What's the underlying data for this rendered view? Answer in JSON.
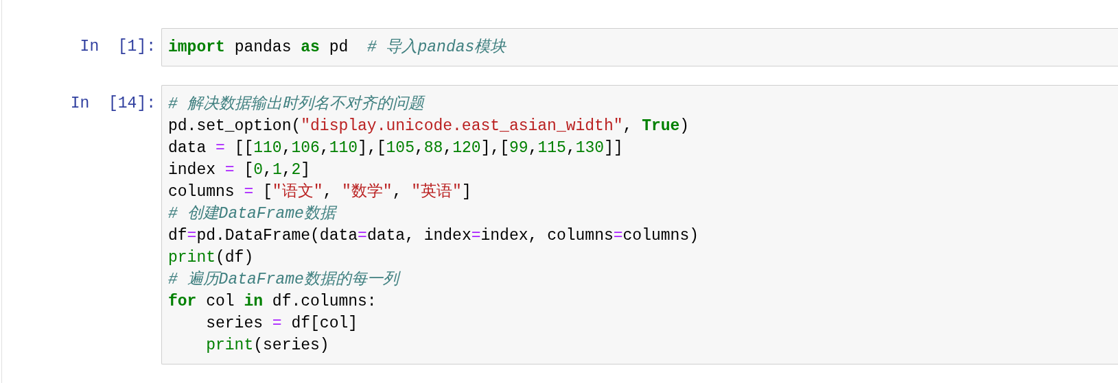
{
  "cells": [
    {
      "prompt": "In  [1]:",
      "lines": [
        {
          "tokens": [
            {
              "kind": "kw",
              "text": "import"
            },
            {
              "kind": "plain",
              "text": " pandas "
            },
            {
              "kind": "kw",
              "text": "as"
            },
            {
              "kind": "plain",
              "text": " pd  "
            },
            {
              "kind": "cmt",
              "text": "# 导入pandas模块"
            }
          ]
        }
      ]
    },
    {
      "prompt": "In  [14]:",
      "lines": [
        {
          "tokens": [
            {
              "kind": "cmt",
              "text": "# 解决数据输出时列名不对齐的问题"
            }
          ]
        },
        {
          "tokens": [
            {
              "kind": "plain",
              "text": "pd.set_option("
            },
            {
              "kind": "str",
              "text": "\"display.unicode.east_asian_width\""
            },
            {
              "kind": "plain",
              "text": ", "
            },
            {
              "kind": "kw",
              "text": "True"
            },
            {
              "kind": "plain",
              "text": ")"
            }
          ]
        },
        {
          "tokens": [
            {
              "kind": "plain",
              "text": "data "
            },
            {
              "kind": "op",
              "text": "="
            },
            {
              "kind": "plain",
              "text": " [["
            },
            {
              "kind": "num",
              "text": "110"
            },
            {
              "kind": "plain",
              "text": ","
            },
            {
              "kind": "num",
              "text": "106"
            },
            {
              "kind": "plain",
              "text": ","
            },
            {
              "kind": "num",
              "text": "110"
            },
            {
              "kind": "plain",
              "text": "],["
            },
            {
              "kind": "num",
              "text": "105"
            },
            {
              "kind": "plain",
              "text": ","
            },
            {
              "kind": "num",
              "text": "88"
            },
            {
              "kind": "plain",
              "text": ","
            },
            {
              "kind": "num",
              "text": "120"
            },
            {
              "kind": "plain",
              "text": "],["
            },
            {
              "kind": "num",
              "text": "99"
            },
            {
              "kind": "plain",
              "text": ","
            },
            {
              "kind": "num",
              "text": "115"
            },
            {
              "kind": "plain",
              "text": ","
            },
            {
              "kind": "num",
              "text": "130"
            },
            {
              "kind": "plain",
              "text": "]]"
            }
          ]
        },
        {
          "tokens": [
            {
              "kind": "plain",
              "text": "index "
            },
            {
              "kind": "op",
              "text": "="
            },
            {
              "kind": "plain",
              "text": " ["
            },
            {
              "kind": "num",
              "text": "0"
            },
            {
              "kind": "plain",
              "text": ","
            },
            {
              "kind": "num",
              "text": "1"
            },
            {
              "kind": "plain",
              "text": ","
            },
            {
              "kind": "num",
              "text": "2"
            },
            {
              "kind": "plain",
              "text": "]"
            }
          ]
        },
        {
          "tokens": [
            {
              "kind": "plain",
              "text": "columns "
            },
            {
              "kind": "op",
              "text": "="
            },
            {
              "kind": "plain",
              "text": " ["
            },
            {
              "kind": "str",
              "text": "\"语文\""
            },
            {
              "kind": "plain",
              "text": ", "
            },
            {
              "kind": "str",
              "text": "\"数学\""
            },
            {
              "kind": "plain",
              "text": ", "
            },
            {
              "kind": "str",
              "text": "\"英语\""
            },
            {
              "kind": "plain",
              "text": "]"
            }
          ]
        },
        {
          "tokens": [
            {
              "kind": "cmt",
              "text": "# 创建DataFrame数据"
            }
          ]
        },
        {
          "tokens": [
            {
              "kind": "plain",
              "text": "df"
            },
            {
              "kind": "op",
              "text": "="
            },
            {
              "kind": "plain",
              "text": "pd.DataFrame(data"
            },
            {
              "kind": "op",
              "text": "="
            },
            {
              "kind": "plain",
              "text": "data, index"
            },
            {
              "kind": "op",
              "text": "="
            },
            {
              "kind": "plain",
              "text": "index, columns"
            },
            {
              "kind": "op",
              "text": "="
            },
            {
              "kind": "plain",
              "text": "columns)"
            }
          ]
        },
        {
          "tokens": [
            {
              "kind": "builtin",
              "text": "print"
            },
            {
              "kind": "plain",
              "text": "(df)"
            }
          ]
        },
        {
          "tokens": [
            {
              "kind": "cmt",
              "text": "# 遍历DataFrame数据的每一列"
            }
          ]
        },
        {
          "tokens": [
            {
              "kind": "kw",
              "text": "for"
            },
            {
              "kind": "plain",
              "text": " col "
            },
            {
              "kind": "kw",
              "text": "in"
            },
            {
              "kind": "plain",
              "text": " df.columns:"
            }
          ]
        },
        {
          "tokens": [
            {
              "kind": "plain",
              "text": "    series "
            },
            {
              "kind": "op",
              "text": "="
            },
            {
              "kind": "plain",
              "text": " df[col]"
            }
          ]
        },
        {
          "tokens": [
            {
              "kind": "builtin",
              "text": "    print"
            },
            {
              "kind": "plain",
              "text": "(series)"
            }
          ]
        }
      ]
    }
  ]
}
